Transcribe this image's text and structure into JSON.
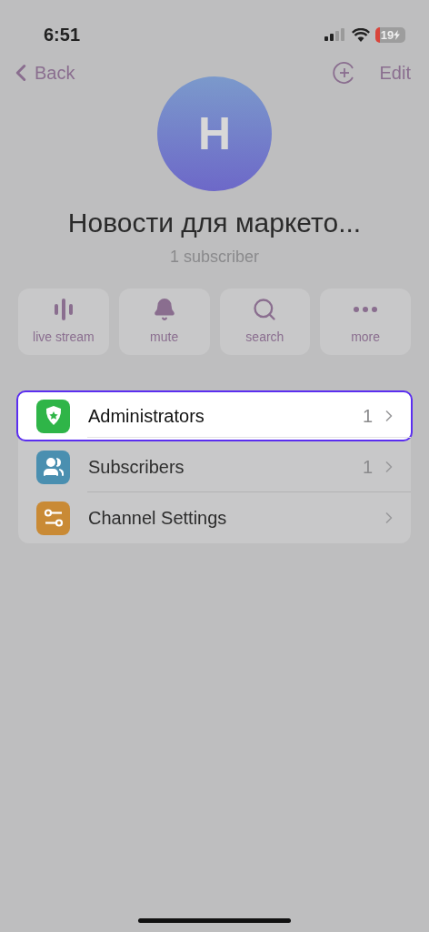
{
  "status_bar": {
    "time": "6:51",
    "battery": "19"
  },
  "nav": {
    "back": "Back",
    "edit": "Edit"
  },
  "channel": {
    "avatar_letter": "H",
    "title": "Новости для маркето...",
    "subtitle": "1 subscriber"
  },
  "actions": [
    {
      "kind": "live",
      "label": "live stream"
    },
    {
      "kind": "mute",
      "label": "mute"
    },
    {
      "kind": "search",
      "label": "search"
    },
    {
      "kind": "more",
      "label": "more"
    }
  ],
  "menu": [
    {
      "kind": "admins",
      "label": "Administrators",
      "count": "1",
      "color": "#2fb548",
      "selected": true
    },
    {
      "kind": "subscribers",
      "label": "Subscribers",
      "count": "1",
      "color": "#4a8fb0",
      "selected": false
    },
    {
      "kind": "settings",
      "label": "Channel Settings",
      "color": "#c98a35",
      "selected": false
    }
  ]
}
